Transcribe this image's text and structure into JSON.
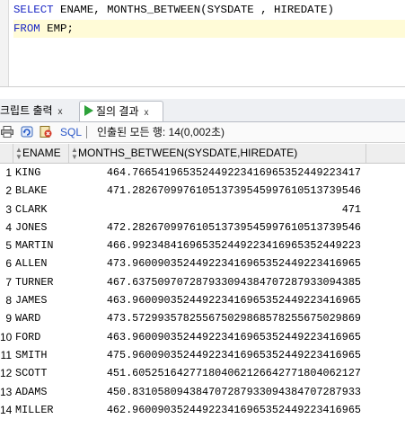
{
  "editor": {
    "line1": {
      "kw": "SELECT",
      "rest": " ENAME, MONTHS_BETWEEN(SYSDATE , HIREDATE)"
    },
    "line2": {
      "kw": "FROM",
      "rest": " EMP;"
    }
  },
  "tabs": [
    {
      "label": "크립트 출력",
      "close": "x"
    },
    {
      "label": "질의 결과",
      "close": "x"
    }
  ],
  "toolbar": {
    "sql_label": "SQL",
    "status": "인출된 모든 행: 14(0,002초)"
  },
  "grid": {
    "columns": [
      "ENAME",
      "MONTHS_BETWEEN(SYSDATE,HIREDATE)"
    ],
    "rows": [
      {
        "n": "1",
        "ename": "KING",
        "value": "464.766541965352449223416965352449223417"
      },
      {
        "n": "2",
        "ename": "BLAKE",
        "value": "471.282670997610513739545997610513739546"
      },
      {
        "n": "3",
        "ename": "CLARK",
        "value": "471"
      },
      {
        "n": "4",
        "ename": "JONES",
        "value": "472.282670997610513739545997610513739546"
      },
      {
        "n": "5",
        "ename": "MARTIN",
        "value": "466.992348416965352449223416965352449223"
      },
      {
        "n": "6",
        "ename": "ALLEN",
        "value": "473.960090352449223416965352449223416965"
      },
      {
        "n": "7",
        "ename": "TURNER",
        "value": "467.637509707287933094384707287933094385"
      },
      {
        "n": "8",
        "ename": "JAMES",
        "value": "463.960090352449223416965352449223416965"
      },
      {
        "n": "9",
        "ename": "WARD",
        "value": "473.572993578255675029868578255675029869"
      },
      {
        "n": "10",
        "ename": "FORD",
        "value": "463.960090352449223416965352449223416965"
      },
      {
        "n": "11",
        "ename": "SMITH",
        "value": "475.960090352449223416965352449223416965"
      },
      {
        "n": "12",
        "ename": "SCOTT",
        "value": "451.605251642771804062126642771804062127"
      },
      {
        "n": "13",
        "ename": "ADAMS",
        "value": "450.831058094384707287933094384707287933"
      },
      {
        "n": "14",
        "ename": "MILLER",
        "value": "462.960090352449223416965352449223416965"
      }
    ]
  },
  "colors": {
    "keyword": "#1a26c4",
    "current_line": "#fffbd7",
    "run_icon": "#2da23a",
    "sql_link": "#2a57c8"
  }
}
